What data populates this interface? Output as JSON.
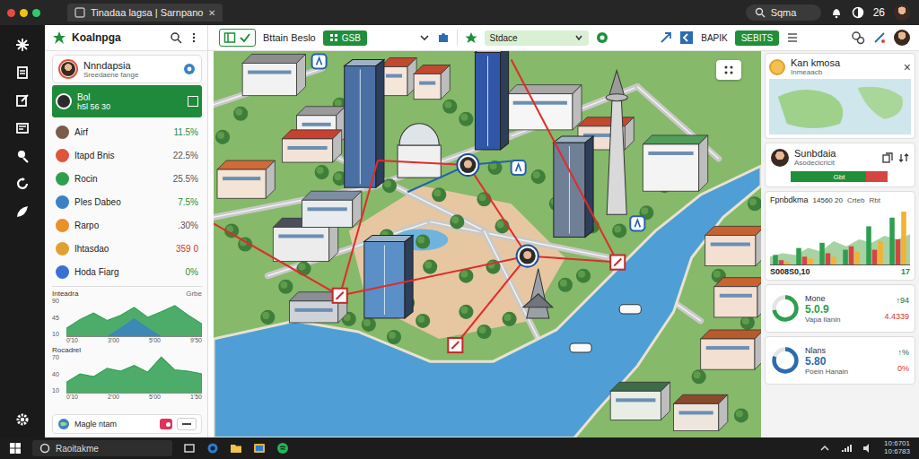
{
  "window": {
    "title": "Tinadaa lagsa | Sarnpano",
    "close": "✕"
  },
  "browser": {
    "search": "Sqma",
    "badge": "26"
  },
  "app": {
    "name": "Koalnpga"
  },
  "toolbar": {
    "title": "Bttain Beslo",
    "primary_button": "GSB",
    "dropdown": "Stdace",
    "label": "BAPIK",
    "action_button": "SEBITS"
  },
  "sidebar": {
    "profile": {
      "name": "Nnndapsia",
      "subtitle": "Sreedaene fange"
    },
    "items": [
      {
        "name": "Bol",
        "detail": "h5l 56 30",
        "selected": true,
        "tone": "neutral",
        "color": "#2b2b2b"
      },
      {
        "name": "Airf",
        "value": "11.5%",
        "selected": false,
        "tone": "positive",
        "color": "#7a5c4a"
      },
      {
        "name": "Itapd Bnis",
        "value": "22.5%",
        "selected": false,
        "tone": "neutral",
        "color": "#e0533d"
      },
      {
        "name": "Rocin",
        "value": "25.5%",
        "selected": false,
        "tone": "neutral",
        "color": "#2e9e4f"
      },
      {
        "name": "Ples Dabeo",
        "value": "7.5%",
        "selected": false,
        "tone": "positive",
        "color": "#3b82c4"
      },
      {
        "name": "Rarpo",
        "value": ".30%",
        "selected": false,
        "tone": "neutral",
        "color": "#e8902a"
      },
      {
        "name": "Ihtasdao",
        "value": "359 0",
        "selected": false,
        "tone": "negative",
        "color": "#e0a030"
      },
      {
        "name": "Hoda Fiarg",
        "value": "0%",
        "selected": false,
        "tone": "positive",
        "color": "#3b6fd4"
      }
    ],
    "charts": [
      {
        "title": "Inteadra",
        "note": "Grbe",
        "y_ticks": [
          "90",
          "45",
          "10"
        ],
        "x_ticks": [
          "0'10",
          "3'00",
          "5'00",
          "9'50"
        ],
        "series": [
          {
            "color": "#2e9e4f",
            "values": [
              20,
              40,
              55,
              38,
              50,
              68,
              45,
              58,
              72,
              50,
              30
            ]
          },
          {
            "color": "#3b82c4",
            "values": [
              0,
              0,
              0,
              0,
              20,
              42,
              20,
              0,
              0,
              0,
              0
            ]
          }
        ]
      },
      {
        "title": "Rocadrel",
        "y_ticks": [
          "70",
          "40",
          "10"
        ],
        "x_ticks": [
          "0'10",
          "2'00",
          "5'00",
          "1'50"
        ],
        "series": [
          {
            "color": "#2e9e4f",
            "values": [
              20,
              35,
              30,
              45,
              40,
              50,
              38,
              65,
              42,
              40,
              35
            ]
          }
        ]
      }
    ],
    "footer": {
      "label": "Magle ntam",
      "toggle_on": true
    }
  },
  "detail": {
    "title": "Kan kmosa",
    "subtitle": "Inmeaacb",
    "close": "×"
  },
  "contact": {
    "name": "Sunbdaia",
    "subtitle": "Asodecicricit",
    "progress_label": "Gbt",
    "level": 0.78
  },
  "chart": {
    "title": "Fpnbdkma",
    "value": "14560 20",
    "label": "Crteb",
    "note": "Rbt",
    "total": "S008S0,10",
    "count": "17",
    "area": [
      10,
      14,
      12,
      20,
      16,
      28,
      22,
      30,
      26,
      34,
      30,
      36
    ],
    "series": [
      {
        "color": "#2e9e4f",
        "values": [
          12,
          20,
          26,
          18,
          45,
          55
        ]
      },
      {
        "color": "#d64541",
        "values": [
          6,
          10,
          14,
          22,
          18,
          30
        ]
      },
      {
        "color": "#f2b233",
        "values": [
          4,
          8,
          10,
          16,
          28,
          62
        ]
      }
    ]
  },
  "stats": [
    {
      "title": "Mone",
      "value": "5.0.9",
      "subtitle": "Vapa Ilanin",
      "delta": "↑94",
      "change": "4.4339",
      "level": 0.72,
      "color": "#2e9e4f"
    },
    {
      "title": "Nlans",
      "value": "5.80",
      "subtitle": "Poein Hanain",
      "delta": "↑%",
      "change": "0%",
      "level": 0.8,
      "color": "#2b6cb0"
    }
  ],
  "taskbar": {
    "search": "Raoitakme",
    "clock": [
      "10:6701",
      "10:6783"
    ]
  }
}
